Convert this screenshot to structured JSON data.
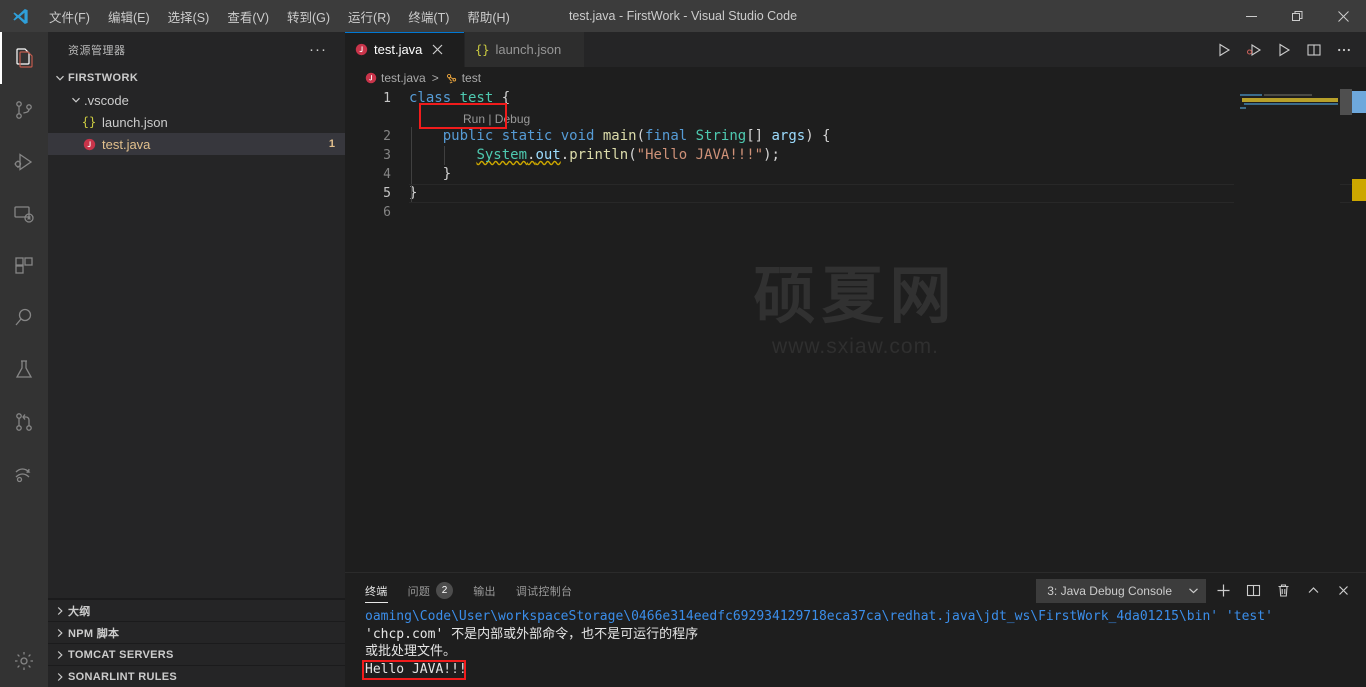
{
  "window": {
    "title": "test.java - FirstWork - Visual Studio Code",
    "logo_icon": "vscode-logo-icon",
    "minimize_icon": "minimize-icon",
    "restore_icon": "restore-icon",
    "close_icon": "close-icon"
  },
  "menubar": {
    "items": [
      {
        "label": "文件(F)",
        "name": "menu-file"
      },
      {
        "label": "编辑(E)",
        "name": "menu-edit"
      },
      {
        "label": "选择(S)",
        "name": "menu-selection"
      },
      {
        "label": "查看(V)",
        "name": "menu-view"
      },
      {
        "label": "转到(G)",
        "name": "menu-go"
      },
      {
        "label": "运行(R)",
        "name": "menu-run"
      },
      {
        "label": "终端(T)",
        "name": "menu-terminal"
      },
      {
        "label": "帮助(H)",
        "name": "menu-help"
      }
    ]
  },
  "activitybar": {
    "items": [
      {
        "icon": "explorer-icon",
        "active": true
      },
      {
        "icon": "source-control-icon",
        "active": false
      },
      {
        "icon": "run-and-debug-icon",
        "active": false
      },
      {
        "icon": "remote-explorer-icon",
        "active": false
      },
      {
        "icon": "extensions-icon",
        "active": false
      },
      {
        "icon": "search-icon",
        "active": false
      },
      {
        "icon": "testing-flask-icon",
        "active": false
      },
      {
        "icon": "pull-request-icon",
        "active": false
      },
      {
        "icon": "live-share-icon",
        "active": false
      }
    ],
    "settings_icon": "settings-gear-icon"
  },
  "sidebar": {
    "title": "资源管理器",
    "more_actions": "···",
    "tree": [
      {
        "label": "FIRSTWORK",
        "kind": "root",
        "expanded": true,
        "indent": 0
      },
      {
        "label": ".vscode",
        "kind": "folder",
        "expanded": true,
        "indent": 1
      },
      {
        "label": "launch.json",
        "kind": "json",
        "indent": 2
      },
      {
        "label": "test.java",
        "kind": "java",
        "indent": 2,
        "selected": true,
        "badge": "1"
      }
    ],
    "sections": [
      {
        "label": "大纲",
        "name": "section-outline"
      },
      {
        "label": "NPM 脚本",
        "name": "section-npm-scripts"
      },
      {
        "label": "TOMCAT SERVERS",
        "name": "section-tomcat-servers"
      },
      {
        "label": "SONARLINT RULES",
        "name": "section-sonarlint-rules"
      }
    ]
  },
  "editor": {
    "tabs": [
      {
        "label": "test.java",
        "icon": "java-file-icon",
        "active": true,
        "close_icon": "close-icon"
      },
      {
        "label": "launch.json",
        "icon": "json-file-icon",
        "active": false
      }
    ],
    "actions": [
      {
        "icon": "run-java-icon",
        "name": "run-java-button"
      },
      {
        "icon": "debug-java-icon",
        "name": "debug-java-button"
      },
      {
        "icon": "run-code-icon",
        "name": "run-code-button"
      },
      {
        "icon": "split-editor-icon",
        "name": "split-editor-button"
      },
      {
        "icon": "more-actions-icon",
        "name": "editor-more-actions-button"
      }
    ],
    "breadcrumb": {
      "file": "test.java",
      "separator": ">",
      "symbol": "test"
    },
    "codelens": "Run | Debug",
    "lines": [
      {
        "num": "1",
        "tokens": [
          {
            "t": "class ",
            "c": "kw"
          },
          {
            "t": "test",
            "c": "type"
          },
          {
            "t": " {",
            "c": "punct"
          }
        ]
      },
      {
        "num": "2",
        "tokens": [
          {
            "t": "    ",
            "c": "punct"
          },
          {
            "t": "public static void ",
            "c": "kw"
          },
          {
            "t": "main",
            "c": "fn"
          },
          {
            "t": "(",
            "c": "punct"
          },
          {
            "t": "final ",
            "c": "kw"
          },
          {
            "t": "String",
            "c": "type"
          },
          {
            "t": "[] ",
            "c": "punct"
          },
          {
            "t": "args",
            "c": "var"
          },
          {
            "t": ") {",
            "c": "punct"
          }
        ]
      },
      {
        "num": "3",
        "tokens": [
          {
            "t": "        ",
            "c": "punct"
          },
          {
            "t": "System",
            "c": "type"
          },
          {
            "t": ".",
            "c": "punct"
          },
          {
            "t": "out",
            "c": "var"
          },
          {
            "t": ".",
            "c": "punct"
          },
          {
            "t": "println",
            "c": "fn"
          },
          {
            "t": "(",
            "c": "punct"
          },
          {
            "t": "\"Hello JAVA!!!\"",
            "c": "str"
          },
          {
            "t": ");",
            "c": "punct"
          }
        ]
      },
      {
        "num": "4",
        "tokens": [
          {
            "t": "    }",
            "c": "punct"
          }
        ]
      },
      {
        "num": "5",
        "tokens": [
          {
            "t": "}",
            "c": "punct"
          }
        ]
      },
      {
        "num": "6",
        "tokens": [
          {
            "t": "",
            "c": "punct"
          }
        ]
      }
    ],
    "watermark_main": "硕夏网",
    "watermark_sub": "www.sxiaw.com."
  },
  "panel": {
    "tabs": [
      {
        "label": "终端",
        "active": true,
        "name": "panel-tab-terminal"
      },
      {
        "label": "问题",
        "active": false,
        "badge": "2",
        "name": "panel-tab-problems"
      },
      {
        "label": "输出",
        "active": false,
        "name": "panel-tab-output"
      },
      {
        "label": "调试控制台",
        "active": false,
        "name": "panel-tab-debug-console"
      }
    ],
    "terminal_select": "3: Java Debug Console",
    "select_chevron_icon": "chevron-down-icon",
    "actions": [
      {
        "icon": "add-terminal-icon",
        "name": "new-terminal-button",
        "glyph": "+"
      },
      {
        "icon": "split-terminal-icon",
        "name": "split-terminal-button"
      },
      {
        "icon": "trash-icon",
        "name": "kill-terminal-button"
      },
      {
        "icon": "chevron-up-icon",
        "name": "maximize-panel-button"
      },
      {
        "icon": "close-icon",
        "name": "close-panel-button"
      }
    ],
    "terminal_lines": [
      {
        "text": "oaming\\Code\\User\\workspaceStorage\\0466e314eedfc692934129718eca37ca\\redhat.java\\jdt_ws\\FirstWork_4da01215\\bin' 'test'",
        "color": "blue"
      },
      {
        "text": "'chcp.com' 不是内部或外部命令，也不是可运行的程序",
        "color": "white"
      },
      {
        "text": "或批处理文件。",
        "color": "white"
      },
      {
        "text": "Hello JAVA!!!",
        "color": "white",
        "highlighted": true
      }
    ]
  },
  "annotations": {
    "accent_red": "#f01c1c",
    "accent_blue": "#0078d4"
  }
}
